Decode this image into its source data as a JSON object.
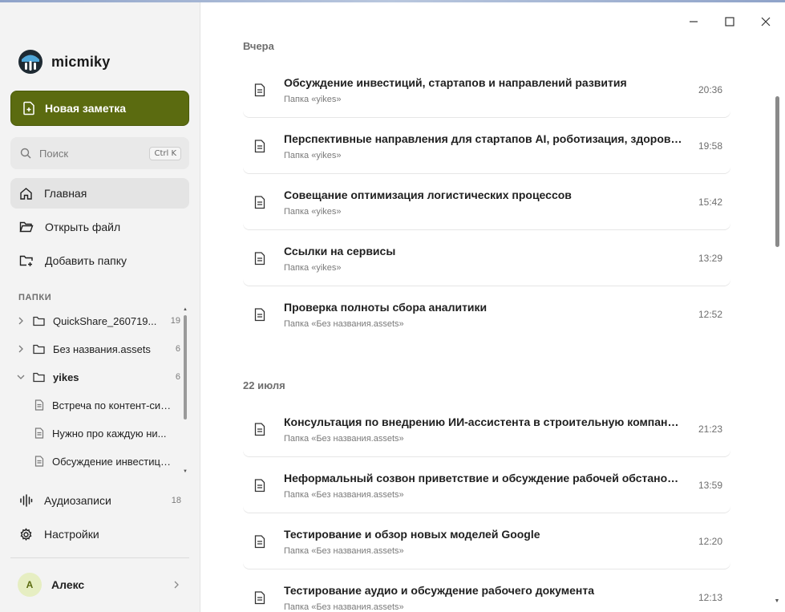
{
  "app": {
    "name": "micmiky"
  },
  "sidebar": {
    "new_note_label": "Новая заметка",
    "search": {
      "placeholder": "Поиск",
      "shortcut": "Ctrl K"
    },
    "nav": [
      {
        "label": "Главная",
        "icon": "home-icon",
        "active": true
      },
      {
        "label": "Открыть файл",
        "icon": "folder-open-icon"
      },
      {
        "label": "Добавить папку",
        "icon": "folder-add-icon"
      }
    ],
    "folders_label": "ПАПКИ",
    "folders": [
      {
        "name": "QuickShare_260719...",
        "count": "19",
        "expanded": false
      },
      {
        "name": "Без названия.assets",
        "count": "6",
        "expanded": false
      },
      {
        "name": "yikes",
        "count": "6",
        "expanded": true
      }
    ],
    "folder_files": [
      {
        "name": "Встреча по контент-сис..."
      },
      {
        "name": "Нужно про каждую ни..."
      },
      {
        "name": "Обсуждение инвестици..."
      }
    ],
    "audio": {
      "label": "Аудиозаписи",
      "count": "18"
    },
    "settings_label": "Настройки",
    "user": {
      "initial": "А",
      "name": "Алекс"
    }
  },
  "main": {
    "groups": [
      {
        "title": "Вчера",
        "notes": [
          {
            "title": "Обсуждение инвестиций, стартапов и направлений развития",
            "folder": "Папка «yikes»",
            "time": "20:36"
          },
          {
            "title": "Перспективные направления для стартапов AI, роботизация, здоровье, EdT...",
            "folder": "Папка «yikes»",
            "time": "19:58"
          },
          {
            "title": "Совещание оптимизация логистических процессов",
            "folder": "Папка «yikes»",
            "time": "15:42"
          },
          {
            "title": "Ссылки на сервисы",
            "folder": "Папка «yikes»",
            "time": "13:29"
          },
          {
            "title": "Проверка полноты сбора аналитики",
            "folder": "Папка «Без названия.assets»",
            "time": "12:52"
          }
        ]
      },
      {
        "title": "22 июля",
        "notes": [
          {
            "title": "Консультация по внедрению ИИ-ассистента в строительную компанию",
            "folder": "Папка «Без названия.assets»",
            "time": "21:23"
          },
          {
            "title": "Неформальный созвон приветствие и обсуждение рабочей обстановки",
            "folder": "Папка «Без названия.assets»",
            "time": "13:59"
          },
          {
            "title": "Тестирование и обзор новых моделей Google",
            "folder": "Папка «Без названия.assets»",
            "time": "12:20"
          },
          {
            "title": "Тестирование аудио и обсуждение рабочего документа",
            "folder": "Папка «Без названия.assets»",
            "time": "12:13"
          }
        ]
      }
    ]
  },
  "colors": {
    "accent": "#5b6b10",
    "sidebar_bg": "#f3f3f3"
  }
}
